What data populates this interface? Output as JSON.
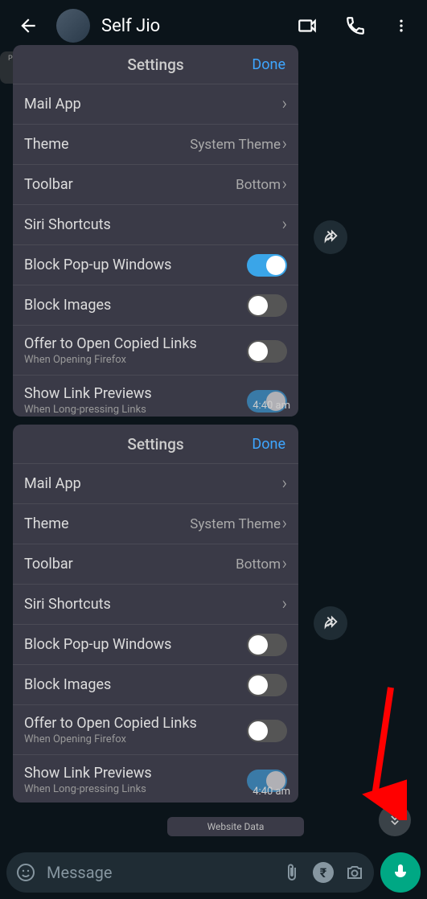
{
  "header": {
    "contact_name": "Self Jio"
  },
  "bubbles": [
    {
      "title": "Settings",
      "done": "Done",
      "rows": [
        {
          "label": "Mail App",
          "value": "",
          "chevron": true
        },
        {
          "label": "Theme",
          "value": "System Theme",
          "chevron": true
        },
        {
          "label": "Toolbar",
          "value": "Bottom",
          "chevron": true
        },
        {
          "label": "Siri Shortcuts",
          "value": "",
          "chevron": true
        },
        {
          "label": "Block Pop-up Windows",
          "toggle": true,
          "on": true
        },
        {
          "label": "Block Images",
          "toggle": true,
          "on": false
        },
        {
          "label": "Offer to Open Copied Links",
          "sub": "When Opening Firefox",
          "toggle": true,
          "on": false
        },
        {
          "label": "Show Link Previews",
          "sub": "When Long-pressing Links",
          "toggle": true,
          "on": true
        }
      ],
      "time": "4:40 am"
    },
    {
      "title": "Settings",
      "done": "Done",
      "rows": [
        {
          "label": "Mail App",
          "value": "",
          "chevron": true
        },
        {
          "label": "Theme",
          "value": "System Theme",
          "chevron": true
        },
        {
          "label": "Toolbar",
          "value": "Bottom",
          "chevron": true
        },
        {
          "label": "Siri Shortcuts",
          "value": "",
          "chevron": true
        },
        {
          "label": "Block Pop-up Windows",
          "toggle": true,
          "on": false
        },
        {
          "label": "Block Images",
          "toggle": true,
          "on": false
        },
        {
          "label": "Offer to Open Copied Links",
          "sub": "When Opening Firefox",
          "toggle": true,
          "on": false
        },
        {
          "label": "Show Link Previews",
          "sub": "When Long-pressing Links",
          "toggle": true,
          "on": true
        }
      ],
      "time": "4:40 am"
    }
  ],
  "privacy_label": "PRIVACY",
  "website_data": "Website Data",
  "input": {
    "placeholder": "Message"
  }
}
